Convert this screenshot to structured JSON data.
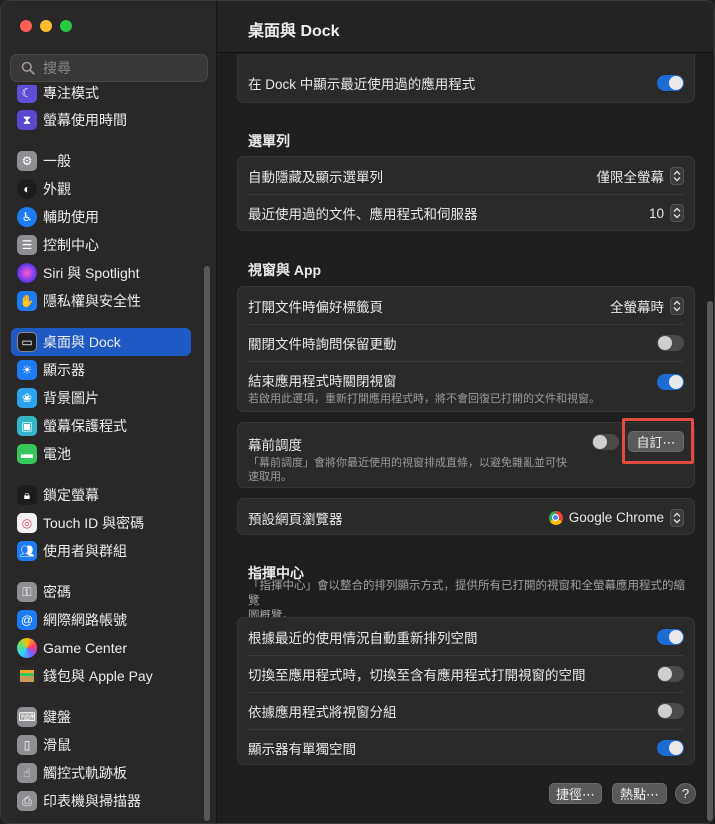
{
  "window": {
    "title": "桌面與 Dock"
  },
  "search": {
    "placeholder": "搜尋"
  },
  "sidebar": {
    "items": [
      {
        "label": "專注模式",
        "icon": "moon-icon",
        "color": "#5e4fd6"
      },
      {
        "label": "螢幕使用時間",
        "icon": "hourglass-icon",
        "color": "#5a48d0"
      },
      {
        "label": "一般",
        "icon": "gear-icon",
        "color": "#8e8e93"
      },
      {
        "label": "外觀",
        "icon": "appearance-icon",
        "color": "#1c1c1e"
      },
      {
        "label": "輔助使用",
        "icon": "accessibility-icon",
        "color": "#1b7cf5"
      },
      {
        "label": "控制中心",
        "icon": "control-center-icon",
        "color": "#8e8e93"
      },
      {
        "label": "Siri 與 Spotlight",
        "icon": "siri-icon",
        "color": "#b84ad8"
      },
      {
        "label": "隱私權與安全性",
        "icon": "hand-icon",
        "color": "#1b7cf5"
      },
      {
        "label": "桌面與 Dock",
        "icon": "dock-icon",
        "color": "#1c1c1e"
      },
      {
        "label": "顯示器",
        "icon": "sun-icon",
        "color": "#1b7cf5"
      },
      {
        "label": "背景圖片",
        "icon": "flower-icon",
        "color": "#2aa4f0"
      },
      {
        "label": "螢幕保護程式",
        "icon": "screensaver-icon",
        "color": "#34b5c8"
      },
      {
        "label": "電池",
        "icon": "battery-icon",
        "color": "#35c759"
      },
      {
        "label": "鎖定螢幕",
        "icon": "lock-icon",
        "color": "#1c1c1e"
      },
      {
        "label": "Touch ID 與密碼",
        "icon": "fingerprint-icon",
        "color": "#f2f2f2"
      },
      {
        "label": "使用者與群組",
        "icon": "users-icon",
        "color": "#1b7cf5"
      },
      {
        "label": "密碼",
        "icon": "key-icon",
        "color": "#8e8e93"
      },
      {
        "label": "網際網路帳號",
        "icon": "at-icon",
        "color": "#1b7cf5"
      },
      {
        "label": "Game Center",
        "icon": "game-center-icon",
        "color": "#f2f2f2"
      },
      {
        "label": "錢包與 Apple Pay",
        "icon": "wallet-icon",
        "color": "#2c2c2e"
      },
      {
        "label": "鍵盤",
        "icon": "keyboard-icon",
        "color": "#8e8e93"
      },
      {
        "label": "滑鼠",
        "icon": "mouse-icon",
        "color": "#8e8e93"
      },
      {
        "label": "觸控式軌跡板",
        "icon": "trackpad-icon",
        "color": "#8e8e93"
      },
      {
        "label": "印表機與掃描器",
        "icon": "printer-icon",
        "color": "#8e8e93"
      }
    ]
  },
  "dock_section": {
    "recent_apps_label": "在 Dock 中顯示最近使用過的應用程式",
    "recent_apps_on": true
  },
  "menubar": {
    "title": "選單列",
    "autohide_label": "自動隱藏及顯示選單列",
    "autohide_value": "僅限全螢幕",
    "recent_items_label": "最近使用過的文件、應用程式和伺服器",
    "recent_items_value": "10"
  },
  "windows_apps": {
    "title": "視窗與 App",
    "prefer_tabs_label": "打開文件時偏好標籤頁",
    "prefer_tabs_value": "全螢幕時",
    "ask_keep_changes_label": "關閉文件時詢問保留更動",
    "ask_keep_changes_on": false,
    "close_windows_label": "結束應用程式時關閉視窗",
    "close_windows_sub": "若啟用此選項，重新打開應用程式時，將不會回復已打開的文件和視窗。",
    "close_windows_on": true,
    "stage_manager_label": "幕前調度",
    "stage_manager_sub_1": "「幕前調度」會將你最近使用的視窗排成直條，以避免雜亂並可快",
    "stage_manager_sub_2": "速取用。",
    "stage_manager_on": false,
    "customize_button": "自訂⋯",
    "default_browser_label": "預設網頁瀏覽器",
    "default_browser_value": "Google Chrome"
  },
  "mission_control": {
    "title": "指揮中心",
    "desc_1": "「指揮中心」會以整合的排列顯示方式，提供所有已打開的視窗和全螢幕應用程式的縮覽",
    "desc_2": "圖概覽。",
    "rearrange_label": "根據最近的使用情況自動重新排列空間",
    "rearrange_on": true,
    "switch_space_label": "切換至應用程式時，切換至含有應用程式打開視窗的空間",
    "switch_space_on": false,
    "group_windows_label": "依據應用程式將視窗分組",
    "group_windows_on": false,
    "separate_spaces_label": "顯示器有單獨空間",
    "separate_spaces_on": true
  },
  "footer": {
    "shortcuts_button": "捷徑⋯",
    "hot_corners_button": "熱點⋯",
    "help_button": "?"
  },
  "colors": {
    "accent": "#1e6bd6",
    "selection": "#1f5ac4",
    "highlight_box": "#e34a42"
  }
}
